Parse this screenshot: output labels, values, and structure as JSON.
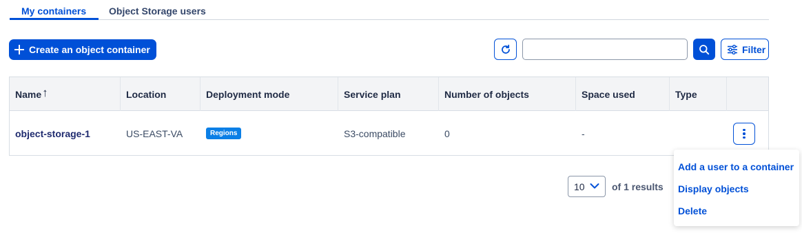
{
  "tabs": [
    {
      "label": "My containers",
      "active": true
    },
    {
      "label": "Object Storage users",
      "active": false
    }
  ],
  "toolbar": {
    "create_label": "Create an object container",
    "search_value": "",
    "filter_label": "Filter"
  },
  "table": {
    "columns": [
      "Name",
      "Location",
      "Deployment mode",
      "Service plan",
      "Number of objects",
      "Space used",
      "Type"
    ],
    "sort_indicator": "↑",
    "rows": [
      {
        "name": "object-storage-1",
        "location": "US-EAST-VA",
        "deployment_mode": "Regions",
        "service_plan": "S3-compatible",
        "number_of_objects": "0",
        "space_used": "-",
        "type": ""
      }
    ]
  },
  "pagination": {
    "page_size": "10",
    "results_text": "of 1 results"
  },
  "menu": {
    "items": [
      "Add a user to a container",
      "Display objects",
      "Delete"
    ]
  },
  "colors": {
    "primary": "#0050d7",
    "badge": "#0b7fe6",
    "header_bg": "#f3f4f6"
  }
}
